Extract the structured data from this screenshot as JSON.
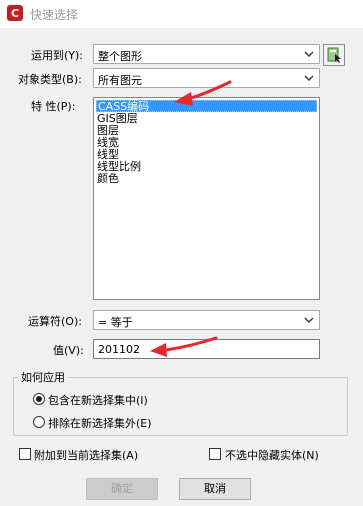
{
  "window": {
    "title": "快速选择"
  },
  "form": {
    "apply_to": {
      "label": "运用到(Y):",
      "value": "整个图形"
    },
    "object_type": {
      "label": "对象类型(B):",
      "value": "所有图元"
    },
    "properties": {
      "label": "特 性(P):",
      "items": [
        "CASS编码",
        "GIS图层",
        "图层",
        "线宽",
        "线型",
        "线型比例",
        "颜色"
      ],
      "selected_index": 0
    },
    "operator": {
      "label": "运算符(O):",
      "value": "= 等于"
    },
    "value": {
      "label": "值(V):",
      "value": "201102"
    }
  },
  "apply_how": {
    "title": "如何应用",
    "include": "包含在新选择集中(I)",
    "exclude": "排除在新选择集外(E)",
    "selected": "include"
  },
  "options": {
    "append": {
      "label": "附加到当前选择集(A)",
      "checked": false
    },
    "hide_unselected": {
      "label": "不选中隐藏实体(N)",
      "checked": false
    }
  },
  "buttons": {
    "ok": "确定",
    "cancel": "取消"
  },
  "colors": {
    "selection": "#3399ff",
    "annotation_arrow": "#e8262b",
    "app_icon": "#c81e1e"
  }
}
